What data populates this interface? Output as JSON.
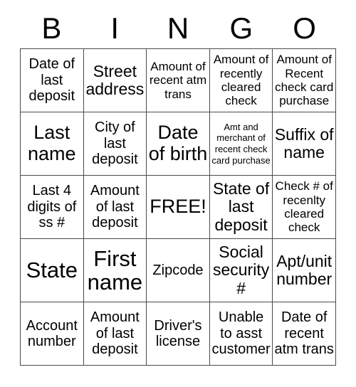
{
  "card": {
    "title": "BINGO",
    "header_letters": [
      "B",
      "I",
      "N",
      "G",
      "O"
    ],
    "free_space_label": "FREE!",
    "colors": {
      "background": "#ffffff",
      "text": "#000000",
      "grid_line": "#4a4a4a"
    },
    "rows": [
      [
        {
          "text": "Date of last deposit",
          "size": "md"
        },
        {
          "text": "Street address",
          "size": "lg"
        },
        {
          "text": "Amount of recent atm trans",
          "size": "sm"
        },
        {
          "text": "Amount of recently cleared check",
          "size": "sm"
        },
        {
          "text": "Amount of Recent check card purchase",
          "size": "sm"
        }
      ],
      [
        {
          "text": "Last name",
          "size": "xl"
        },
        {
          "text": "City of last deposit",
          "size": "md"
        },
        {
          "text": "Date of birth",
          "size": "xl"
        },
        {
          "text": "Amt and merchant of recent check card purchase",
          "size": "xs"
        },
        {
          "text": "Suffix of name",
          "size": "lg"
        }
      ],
      [
        {
          "text": "Last 4 digits of ss #",
          "size": "md"
        },
        {
          "text": "Amount of last deposit",
          "size": "md"
        },
        {
          "text": "FREE!",
          "size": "xl"
        },
        {
          "text": "State of last deposit",
          "size": "lg"
        },
        {
          "text": "Check # of recenlty cleared check",
          "size": "sm"
        }
      ],
      [
        {
          "text": "State",
          "size": "xxl"
        },
        {
          "text": "First name",
          "size": "xxl"
        },
        {
          "text": "Zipcode",
          "size": "md"
        },
        {
          "text": "Social security #",
          "size": "lg"
        },
        {
          "text": "Apt/unit number",
          "size": "lg"
        }
      ],
      [
        {
          "text": "Account number",
          "size": "md"
        },
        {
          "text": "Amount of last deposit",
          "size": "md"
        },
        {
          "text": "Driver's license",
          "size": "md"
        },
        {
          "text": "Unable to asst customer",
          "size": "md"
        },
        {
          "text": "Date of recent atm trans",
          "size": "md"
        }
      ]
    ]
  }
}
